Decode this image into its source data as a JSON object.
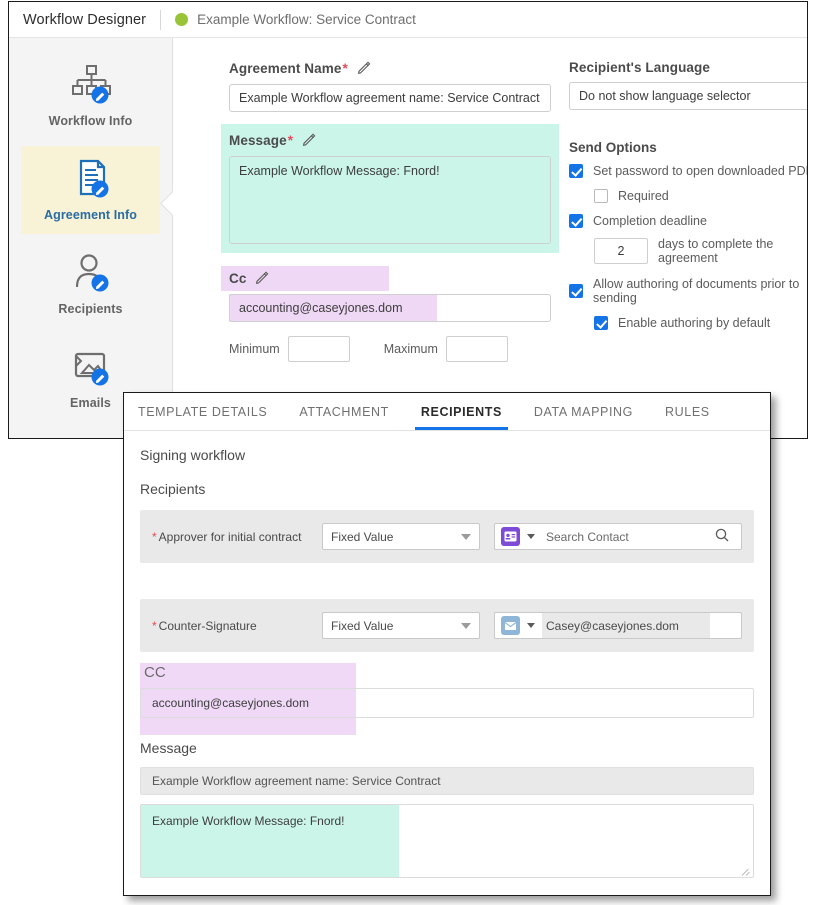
{
  "header": {
    "app_title": "Workflow Designer",
    "workflow_name": "Example Workflow: Service Contract",
    "status_dot_color": "#9ac437"
  },
  "sidebar": {
    "items": [
      {
        "label": "Workflow Info",
        "icon": "org-chart-edit-icon",
        "selected": false
      },
      {
        "label": "Agreement Info",
        "icon": "document-edit-icon",
        "selected": true
      },
      {
        "label": "Recipients",
        "icon": "person-edit-icon",
        "selected": false
      },
      {
        "label": "Emails",
        "icon": "email-image-edit-icon",
        "selected": false
      }
    ]
  },
  "form": {
    "agreement_name": {
      "label": "Agreement Name",
      "required_mark": "*",
      "value": "Example Workflow agreement name: Service Contract"
    },
    "message": {
      "label": "Message",
      "required_mark": "*",
      "value": "Example Workflow Message: Fnord!"
    },
    "cc": {
      "label": "Cc",
      "value": "accounting@caseyjones.dom"
    },
    "minimum": {
      "label": "Minimum",
      "value": ""
    },
    "maximum": {
      "label": "Maximum",
      "value": ""
    },
    "recipients_language": {
      "label": "Recipient's Language",
      "value": "Do not show language selector"
    },
    "send_options": {
      "title": "Send Options",
      "options": [
        {
          "label": "Set password to open downloaded PDF",
          "checked": true,
          "indent": false
        },
        {
          "label": "Required",
          "checked": false,
          "indent": true
        },
        {
          "label": "Completion deadline",
          "checked": true,
          "indent": false
        }
      ],
      "days_value": "2",
      "days_suffix": "days to complete the agreement",
      "options_after": [
        {
          "label": "Allow authoring of documents prior to sending",
          "checked": true,
          "indent": false
        },
        {
          "label": "Enable authoring by default",
          "checked": true,
          "indent": true
        }
      ]
    }
  },
  "dialog": {
    "tabs": [
      {
        "label": "TEMPLATE DETAILS",
        "active": false
      },
      {
        "label": "ATTACHMENT",
        "active": false
      },
      {
        "label": "RECIPIENTS",
        "active": true
      },
      {
        "label": "DATA MAPPING",
        "active": false
      },
      {
        "label": "RULES",
        "active": false
      }
    ],
    "signing_workflow_title": "Signing workflow",
    "recipients_title": "Recipients",
    "recipient_rows": [
      {
        "required_star": "*",
        "label": "Approver for initial contract",
        "select_value": "Fixed Value",
        "type_icon": "contact-card-icon",
        "type_icon_color": "#7d4bd6",
        "field_value": "",
        "field_placeholder": "Search Contact",
        "has_search_icon": true
      },
      {
        "required_star": "*",
        "label": "Counter-Signature",
        "select_value": "Fixed Value",
        "type_icon": "envelope-icon",
        "type_icon_color": "#8fb6d6",
        "field_value": "Casey@caseyjones.dom",
        "field_placeholder": "",
        "has_search_icon": false
      }
    ],
    "cc": {
      "title": "CC",
      "value": "accounting@caseyjones.dom"
    },
    "message": {
      "title": "Message",
      "agreement_name": "Example Workflow agreement name: Service Contract",
      "body": "Example Workflow Message: Fnord!"
    }
  },
  "colors": {
    "accent_blue": "#1473e6",
    "mint_highlight": "#ccf5ea",
    "purple_highlight": "#efd8f5",
    "selected_sidebar": "#f8f3d6",
    "required_red": "#e8475a"
  }
}
